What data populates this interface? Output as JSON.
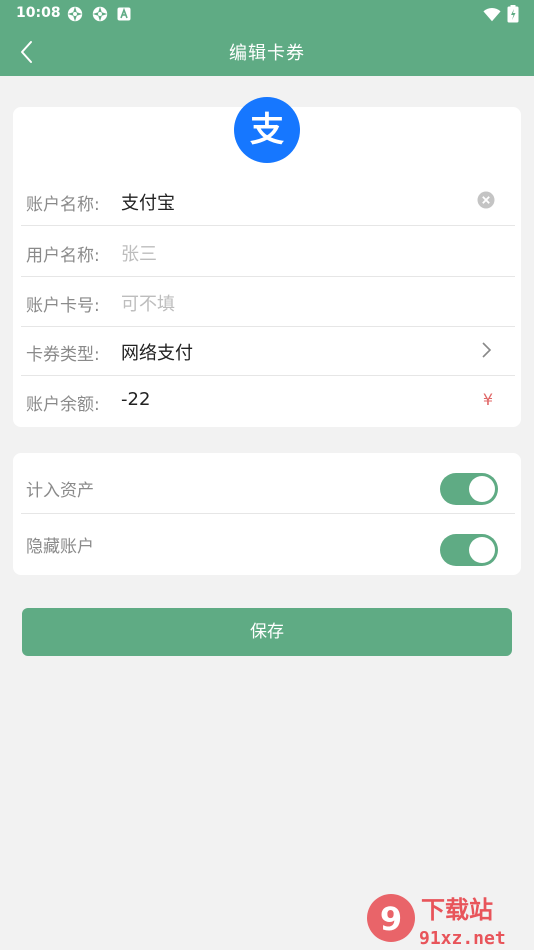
{
  "status_bar": {
    "time": "10:08",
    "icons": [
      "pinwheel-icon",
      "pinwheel-icon",
      "notification-a-icon",
      "wifi-icon",
      "battery-icon"
    ]
  },
  "header": {
    "title": "编辑卡券",
    "back_icon": "chevron-left-icon",
    "background": "#5fab84"
  },
  "account": {
    "logo_icon": "alipay-logo",
    "logo_color": "#1677ff",
    "logo_char": "支",
    "fields": [
      {
        "label": "账户名称:",
        "value": "支付宝",
        "placeholder": "",
        "trailing": "clear-icon"
      },
      {
        "label": "用户名称:",
        "value": "",
        "placeholder": "张三",
        "trailing": ""
      },
      {
        "label": "账户卡号:",
        "value": "",
        "placeholder": "可不填",
        "trailing": ""
      },
      {
        "label": "卡券类型:",
        "value": "网络支付",
        "placeholder": "",
        "trailing": "chevron-right-icon"
      },
      {
        "label": "账户余额:",
        "value": "-22",
        "placeholder": "",
        "trailing": "¥"
      }
    ]
  },
  "settings": [
    {
      "label": "计入资产",
      "enabled": true
    },
    {
      "label": "隐藏账户",
      "enabled": true
    }
  ],
  "save_label": "保存",
  "accent_color": "#5fab84",
  "watermark": {
    "text1": "下载站",
    "text2": "91xz.net"
  }
}
